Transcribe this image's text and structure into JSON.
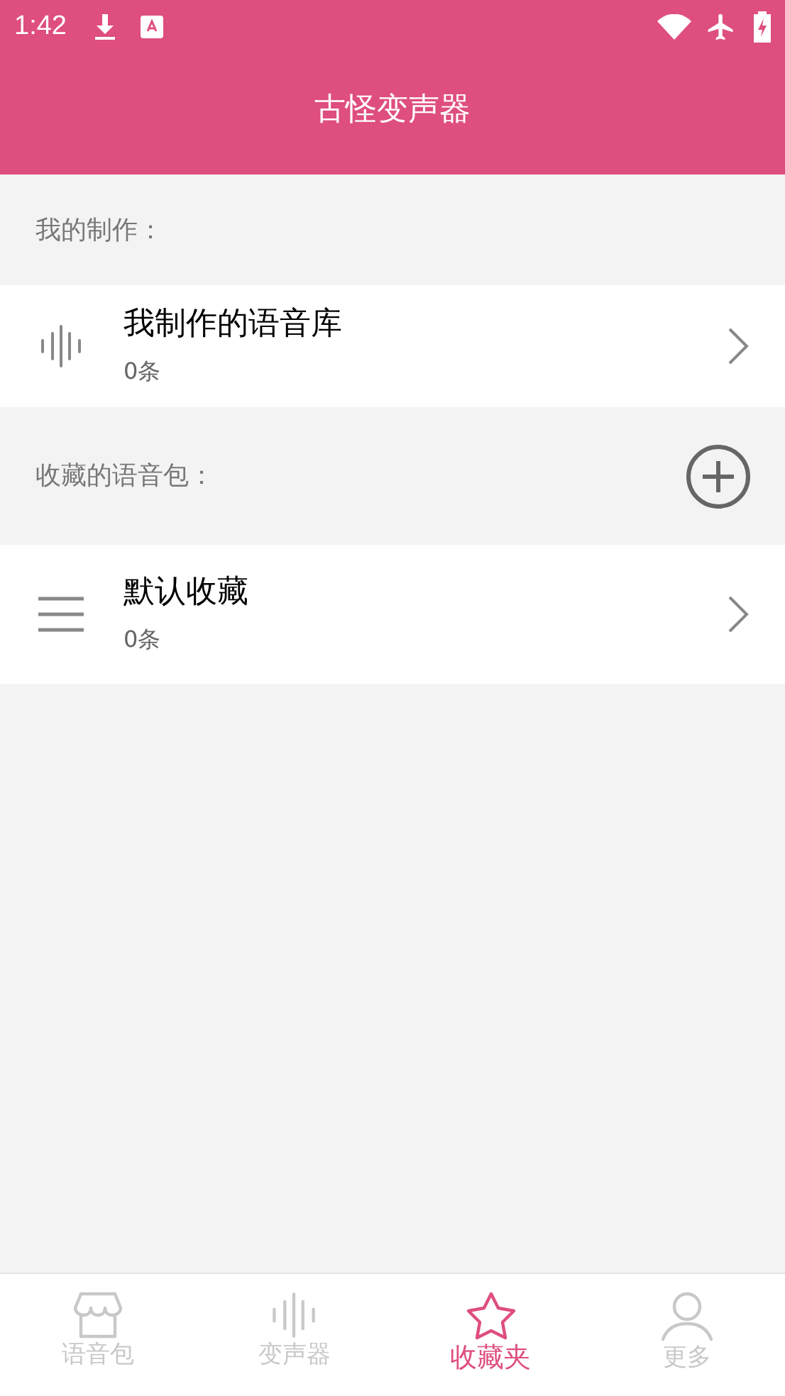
{
  "status_bar": {
    "time": "1:42"
  },
  "app_bar": {
    "title": "古怪变声器"
  },
  "sections": [
    {
      "label": "我的制作：",
      "add_button": false,
      "items": [
        {
          "kind": "wave",
          "title": "我制作的语音库",
          "count": "0条"
        }
      ]
    },
    {
      "label": "收藏的语音包：",
      "add_button": true,
      "items": [
        {
          "kind": "list",
          "title": "默认收藏",
          "count": "0条"
        }
      ]
    }
  ],
  "tabs": [
    {
      "kind": "store",
      "label": "语音包",
      "selected": false
    },
    {
      "kind": "wave",
      "label": "变声器",
      "selected": false
    },
    {
      "kind": "star",
      "label": "收藏夹",
      "selected": true
    },
    {
      "kind": "person",
      "label": "更多",
      "selected": false
    }
  ]
}
